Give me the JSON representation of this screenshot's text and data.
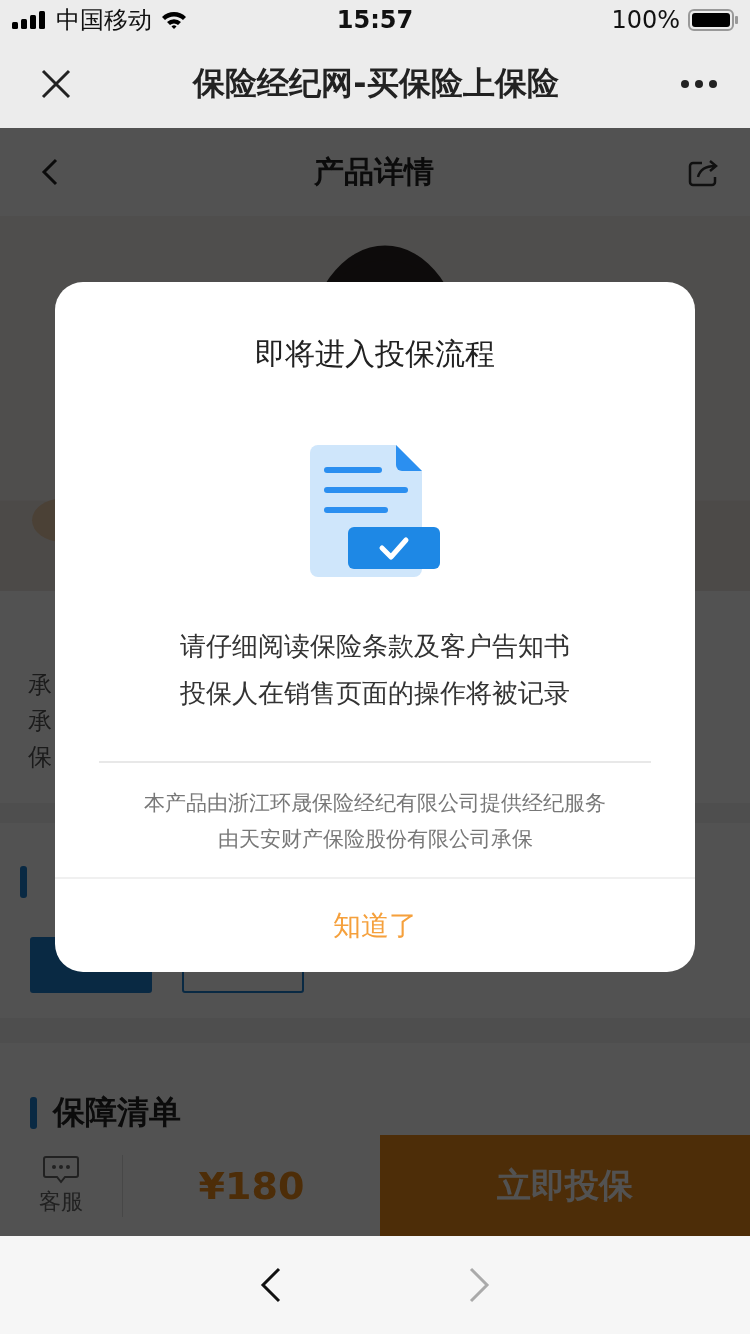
{
  "status_bar": {
    "carrier": "中国移动",
    "time": "15:57",
    "battery": "100%"
  },
  "browser_bar": {
    "title": "保险经纪网-买保险上保险"
  },
  "header": {
    "title": "产品详情"
  },
  "product": {
    "lines": [
      "承",
      "承",
      "保"
    ]
  },
  "plan_section": {
    "tabs": [
      {
        "selected": true
      },
      {
        "selected": false
      }
    ]
  },
  "coverage_section": {
    "title": "保障清单"
  },
  "action_bar": {
    "service": "客服",
    "price": "¥180",
    "buy": "立即投保"
  },
  "dialog": {
    "title": "即将进入投保流程",
    "message": [
      "请仔细阅读保险条款及客户告知书",
      "投保人在销售页面的操作将被记录"
    ],
    "note": [
      "本产品由浙江环晟保险经纪有限公司提供经纪服务",
      "由天安财产保险股份有限公司承保"
    ],
    "button": "知道了"
  },
  "browser_nav": {
    "back_enabled": true,
    "forward_enabled": false
  }
}
